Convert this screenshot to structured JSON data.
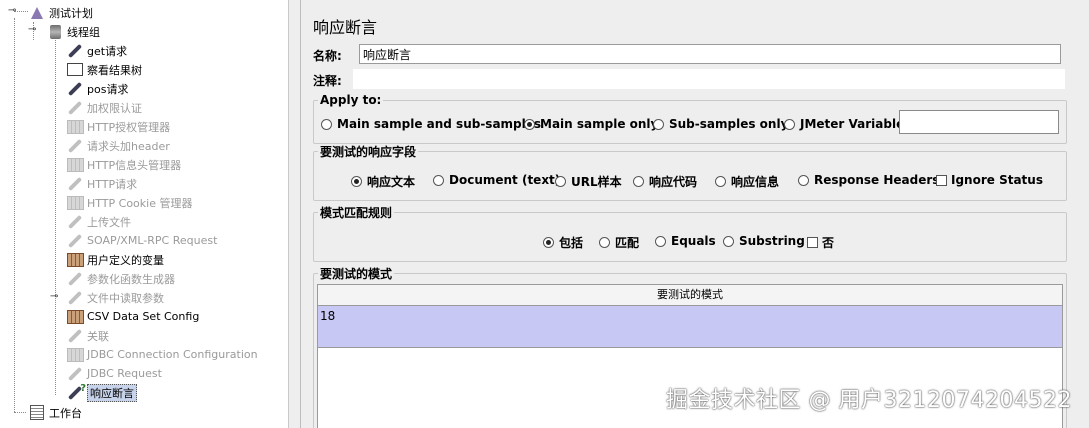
{
  "tree": {
    "items": [
      {
        "label": "测试计划",
        "icon": "flask-icon",
        "disabled": false
      },
      {
        "label": "线程组",
        "icon": "spool-icon",
        "disabled": false
      },
      {
        "label": "get请求",
        "icon": "pen-icon",
        "disabled": false
      },
      {
        "label": "察看结果树",
        "icon": "chart-icon",
        "disabled": false
      },
      {
        "label": "pos请求",
        "icon": "pen-icon",
        "disabled": false
      },
      {
        "label": "加权限认证",
        "icon": "pen-icon",
        "disabled": true
      },
      {
        "label": "HTTP授权管理器",
        "icon": "grid-icon",
        "disabled": true
      },
      {
        "label": "请求头加header",
        "icon": "pen-icon",
        "disabled": true
      },
      {
        "label": "HTTP信息头管理器",
        "icon": "grid-icon",
        "disabled": true
      },
      {
        "label": "HTTP请求",
        "icon": "pen-icon",
        "disabled": true
      },
      {
        "label": "HTTP Cookie 管理器",
        "icon": "grid-icon",
        "disabled": true
      },
      {
        "label": "上传文件",
        "icon": "pen-icon",
        "disabled": true
      },
      {
        "label": "SOAP/XML-RPC Request",
        "icon": "pen-icon",
        "disabled": true
      },
      {
        "label": "用户定义的变量",
        "icon": "grid-icon",
        "disabled": false
      },
      {
        "label": "参数化函数生成器",
        "icon": "pen-icon",
        "disabled": true
      },
      {
        "label": "文件中读取参数",
        "icon": "pen-icon",
        "disabled": true
      },
      {
        "label": "CSV Data Set Config",
        "icon": "grid-icon",
        "disabled": false
      },
      {
        "label": "关联",
        "icon": "pen-icon",
        "disabled": true
      },
      {
        "label": "JDBC Connection Configuration",
        "icon": "grid-icon",
        "disabled": true
      },
      {
        "label": "JDBC Request",
        "icon": "pen-icon",
        "disabled": true
      },
      {
        "label": "响应断言",
        "icon": "assertion-icon",
        "disabled": false,
        "selected": true
      },
      {
        "label": "工作台",
        "icon": "workbench-icon",
        "disabled": false
      }
    ]
  },
  "panel": {
    "title": "响应断言",
    "name_label": "名称:",
    "name_value": "响应断言",
    "comment_label": "注释:"
  },
  "apply_to": {
    "legend": "Apply to:",
    "options": [
      "Main sample and sub-samples",
      "Main sample only",
      "Sub-samples only",
      "JMeter Variable"
    ],
    "selected": "Main sample only"
  },
  "field_to_test": {
    "legend": "要测试的响应字段",
    "options": [
      "响应文本",
      "Document (text)",
      "URL样本",
      "响应代码",
      "响应信息",
      "Response Headers"
    ],
    "selected": "响应文本",
    "ignore_status_label": "Ignore Status",
    "ignore_status_checked": false
  },
  "pattern_matching": {
    "legend": "模式匹配规则",
    "options": [
      "包括",
      "匹配",
      "Equals",
      "Substring"
    ],
    "selected": "包括",
    "not_label": "否",
    "not_checked": false
  },
  "patterns": {
    "legend": "要测试的模式",
    "column_header": "要测试的模式",
    "rows": [
      "18"
    ]
  },
  "watermark": "掘金技术社区 @ 用户3212074204522"
}
